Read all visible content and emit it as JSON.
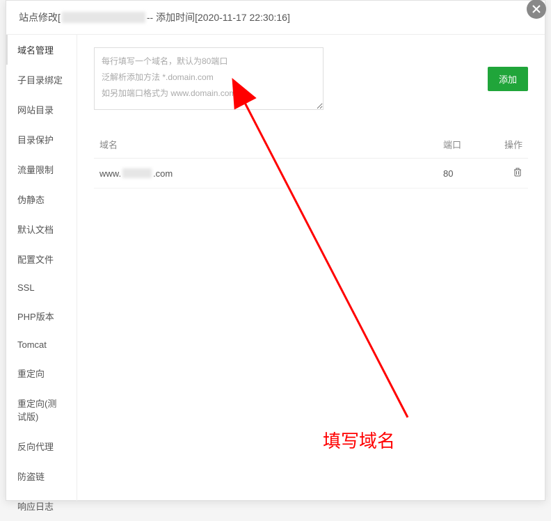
{
  "header": {
    "prefix": "站点修改[",
    "sep": " -- 添加时间[",
    "timestamp": "2020-11-17 22:30:16",
    "suffix": "]"
  },
  "sidebar": {
    "items": [
      "域名管理",
      "子目录绑定",
      "网站目录",
      "目录保护",
      "流量限制",
      "伪静态",
      "默认文档",
      "配置文件",
      "SSL",
      "PHP版本",
      "Tomcat",
      "重定向",
      "重定向(测试版)",
      "反向代理",
      "防盗链",
      "响应日志"
    ],
    "activeIndex": 0
  },
  "content": {
    "textarea_placeholder": "每行填写一个域名，默认为80端口\n泛解析添加方法 *.domain.com\n如另加端口格式为 www.domain.com:88",
    "add_button": "添加",
    "table": {
      "cols": [
        "域名",
        "端口",
        "操作"
      ],
      "rows": [
        {
          "domain_prefix": "www.",
          "domain_suffix": ".com",
          "port": "80"
        }
      ]
    }
  },
  "annotation": {
    "label": "填写域名"
  }
}
